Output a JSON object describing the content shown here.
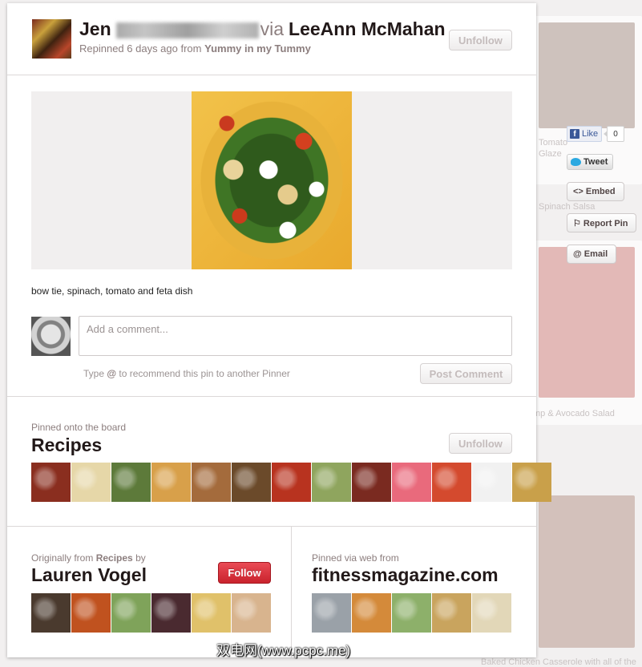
{
  "header": {
    "pinner_name": "Jen",
    "via_label": "via",
    "via_name": "LeeAnn McMahan",
    "repinned_prefix": "Repinned 6 days ago from",
    "repinned_board": "Yummy in my Tummy",
    "unfollow_label": "Unfollow"
  },
  "pin": {
    "description": "bow tie, spinach, tomato and feta dish"
  },
  "comment": {
    "placeholder": "Add a comment...",
    "hint_prefix": "Type",
    "hint_at": "@",
    "hint_suffix": "to recommend this pin to another Pinner",
    "post_label": "Post Comment"
  },
  "board": {
    "label": "Pinned onto the board",
    "name": "Recipes",
    "unfollow_label": "Unfollow",
    "thumbs": [
      "#8a2e1f",
      "#e6d7a8",
      "#5d7a3a",
      "#d8a04a",
      "#a46b3c",
      "#6b4a2a",
      "#b8331f",
      "#8fa55e",
      "#7a2a20",
      "#e96a7c",
      "#d44a2e",
      "#f1f1f1",
      "#c9a04a"
    ]
  },
  "origin": {
    "label_prefix": "Originally from",
    "label_board": "Recipes",
    "label_suffix": "by",
    "name": "Lauren Vogel",
    "follow_label": "Follow",
    "thumbs": [
      "#4a3a2e",
      "#c0521f",
      "#7fa35a",
      "#4a2a30",
      "#e0c16a",
      "#d8b48e"
    ]
  },
  "source": {
    "label": "Pinned via web from",
    "domain": "fitnessmagazine.com",
    "thumbs": [
      "#9aa1a8",
      "#d48a3a",
      "#8db06a",
      "#c9a45e",
      "#e2d7b8"
    ]
  },
  "social": {
    "like_label": "Like",
    "like_count": "0",
    "tweet_label": "Tweet",
    "embed_label": "<> Embed",
    "report_label": "⚐ Report Pin",
    "email_label": "@ Email"
  },
  "watermark": "双电网(www.pcpc.me)",
  "background": {
    "texts": [
      "Tomato",
      "Glaze",
      "Spinach Salsa",
      "mp & Avocado Salad",
      "Baked Chicken Casserole with all of the"
    ]
  }
}
